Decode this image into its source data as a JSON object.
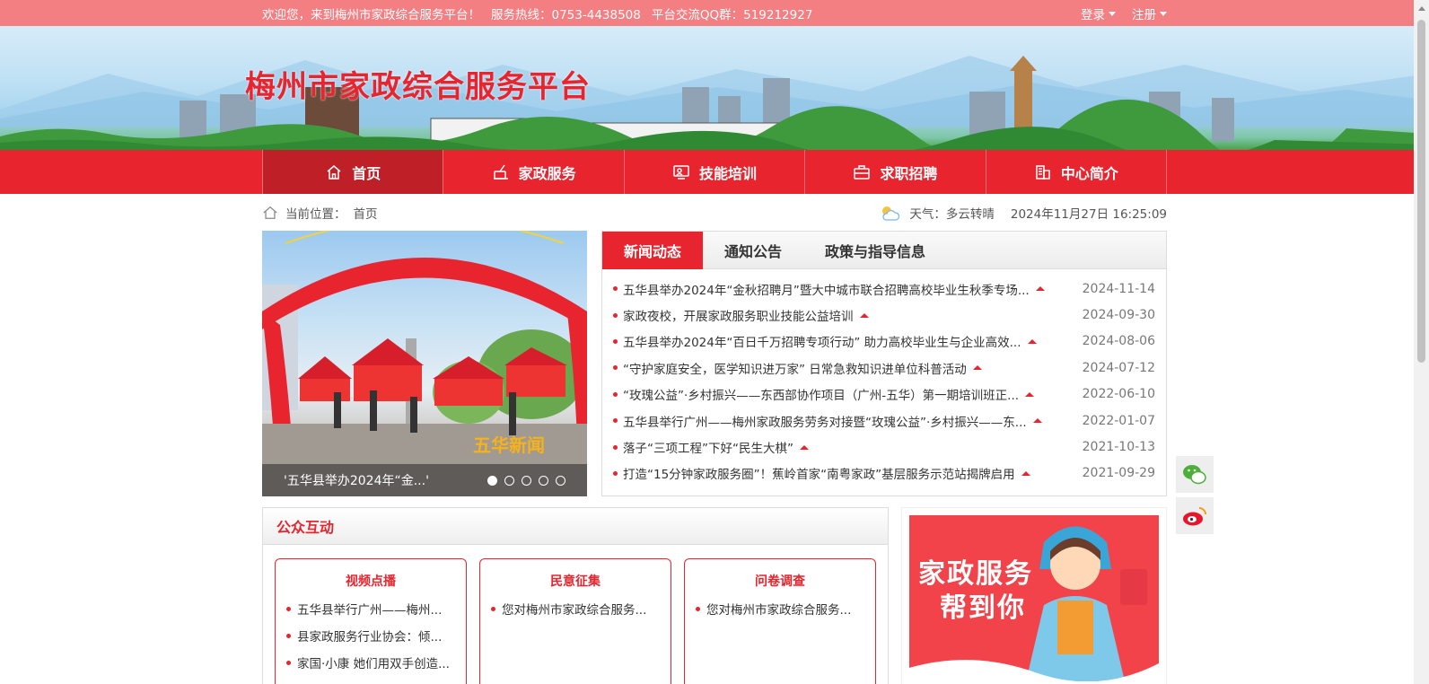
{
  "topbar": {
    "welcome": "欢迎您，来到梅州市家政综合服务平台！",
    "hotline": "服务热线：0753-4438508",
    "qq": "平台交流QQ群：519212927",
    "login": "登录",
    "register": "注册"
  },
  "banner": {
    "title": "梅州市家政综合服务平台"
  },
  "nav": {
    "items": [
      {
        "label": "首页",
        "icon": "home-icon",
        "active": true
      },
      {
        "label": "家政服务",
        "icon": "cleaning-icon"
      },
      {
        "label": "技能培训",
        "icon": "training-icon"
      },
      {
        "label": "求职招聘",
        "icon": "briefcase-icon"
      },
      {
        "label": "中心简介",
        "icon": "building-icon"
      }
    ]
  },
  "crumb": {
    "label": "当前位置：",
    "current": "首页",
    "weather_label": "天气：",
    "weather": "多云转晴",
    "datetime": "2024年11月27日 16:25:09"
  },
  "slider": {
    "caption": "'五华县举办2024年“金...'",
    "dots": 5,
    "watermark": "五华新闻"
  },
  "news": {
    "tabs": [
      "新闻动态",
      "通知公告",
      "政策与指导信息"
    ],
    "items": [
      {
        "title": "五华县举办2024年“金秋招聘月”暨大中城市联合招聘高校毕业生秋季专场...",
        "date": "2024-11-14"
      },
      {
        "title": "家政夜校，开展家政服务职业技能公益培训",
        "date": "2024-09-30"
      },
      {
        "title": "五华县举办2024年“百日千万招聘专项行动” 助力高校毕业生与企业高效...",
        "date": "2024-08-06"
      },
      {
        "title": "“守护家庭安全，医学知识进万家” 日常急救知识进单位科普活动",
        "date": "2024-07-12"
      },
      {
        "title": "“玫瑰公益”·乡村振兴——东西部协作项目（广州-五华）第一期培训班正...",
        "date": "2022-06-10"
      },
      {
        "title": "五华县举行广州——梅州家政服务劳务对接暨“玫瑰公益”·乡村振兴——东...",
        "date": "2022-01-07"
      },
      {
        "title": "落子“三项工程”下好“民生大棋”",
        "date": "2021-10-13"
      },
      {
        "title": "打造“15分钟家政服务圈”！蕉岭首家“南粤家政”基层服务示范站揭牌启用",
        "date": "2021-09-29"
      }
    ]
  },
  "interact": {
    "title": "公众互动",
    "cols": [
      {
        "title": "视频点播",
        "items": [
          "五华县举行广州——梅州...",
          "县家政服务行业协会：倾...",
          "家国·小康 她们用双手创造..."
        ]
      },
      {
        "title": "民意征集",
        "items": [
          "您对梅州市家政综合服务..."
        ]
      },
      {
        "title": "问卷调查",
        "items": [
          "您对梅州市家政综合服务..."
        ]
      }
    ]
  },
  "promo": {
    "line1": "家政服务",
    "line2": "帮到你"
  },
  "colors": {
    "brand_red": "#e8242e",
    "topbar": "#f47f82"
  }
}
